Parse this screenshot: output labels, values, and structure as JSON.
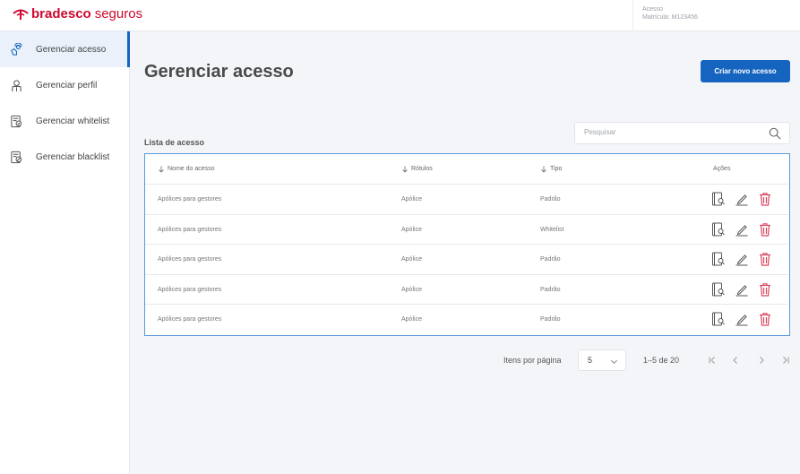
{
  "header": {
    "logo_bold": "bradesco",
    "logo_thin": "seguros",
    "user_line1": "Acesso",
    "user_line2": "Matrícula: M123456"
  },
  "sidebar": {
    "items": [
      {
        "label": "Gerenciar acesso",
        "icon": "touch-access-icon",
        "active": true
      },
      {
        "label": "Gerenciar perfil",
        "icon": "person-icon",
        "active": false
      },
      {
        "label": "Gerenciar whitelist",
        "icon": "document-check-icon",
        "active": false
      },
      {
        "label": "Gerenciar blacklist",
        "icon": "document-block-icon",
        "active": false
      }
    ]
  },
  "main": {
    "title": "Gerenciar acesso",
    "create_button": "Criar novo acesso",
    "list_label": "Lista de acesso",
    "search_placeholder": "Pesquisar"
  },
  "table": {
    "columns": [
      "Nome do acesso",
      "Rótulos",
      "Tipo",
      "Ações"
    ],
    "rows": [
      [
        "Apólices para gestores",
        "Apólice",
        "Padrão"
      ],
      [
        "Apólices para gestores",
        "Apólice",
        "Whitelist"
      ],
      [
        "Apólices para gestores",
        "Apólice",
        "Padrão"
      ],
      [
        "Apólices para gestores",
        "Apólice",
        "Padrão"
      ],
      [
        "Apólices para gestores",
        "Apólice",
        "Padrão"
      ]
    ]
  },
  "pagination": {
    "per_page_label": "Itens por página",
    "per_page_value": "5",
    "range": "1–5 de 20"
  },
  "colors": {
    "brand_red": "#cc092f",
    "primary_blue": "#1565c0",
    "delete_red": "#d9455f"
  }
}
